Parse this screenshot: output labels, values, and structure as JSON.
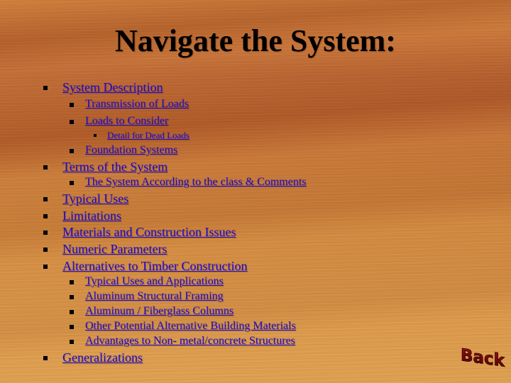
{
  "slide": {
    "title": "Navigate the System:",
    "link_color": "#1a0ad6",
    "items": [
      {
        "level": 1,
        "label": "System Description"
      },
      {
        "level": 2,
        "label": "Transmission of Loads"
      },
      {
        "level": 2,
        "label": "Loads to Consider"
      },
      {
        "level": 3,
        "label": "Detail for Dead Loads"
      },
      {
        "level": 2,
        "label": "Foundation Systems"
      },
      {
        "level": 1,
        "label": "Terms of the System"
      },
      {
        "level": 2,
        "label": "The System According to the class & Comments"
      },
      {
        "level": 1,
        "label": "Typical Uses"
      },
      {
        "level": 1,
        "label": "Limitations"
      },
      {
        "level": 1,
        "label": "Materials and Construction Issues"
      },
      {
        "level": 1,
        "label": "Numeric Parameters"
      },
      {
        "level": 1,
        "label": "Alternatives to Timber Construction"
      },
      {
        "level": 2,
        "label": "Typical Uses and Applications"
      },
      {
        "level": 2,
        "label": "Aluminum Structural Framing"
      },
      {
        "level": 2,
        "label": "Aluminum / Fiberglass Columns"
      },
      {
        "level": 2,
        "label": "Other Potential Alternative Building Materials"
      },
      {
        "level": 2,
        "label": "Advantages to Non- metal/concrete Structures"
      },
      {
        "level": 1,
        "label": "Generalizations"
      }
    ],
    "back_button": {
      "label": "Back",
      "color": "#7a0a0a"
    }
  }
}
